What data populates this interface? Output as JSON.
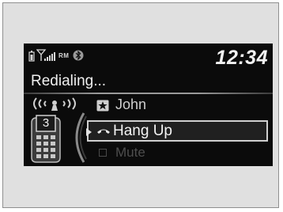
{
  "status": {
    "roaming_text": "RM",
    "clock": "12:34",
    "icons": [
      "phone-battery-icon",
      "signal-strength-icon",
      "bluetooth-icon"
    ]
  },
  "call": {
    "status": "Redialing...",
    "speed_dial_number": "3"
  },
  "menu": {
    "contact_name": "John",
    "contact_icon": "star-icon",
    "hang_up_label": "Hang Up",
    "hang_up_icon": "hang-up-icon",
    "mute_label": "Mute",
    "selected": "Hang Up"
  },
  "colors": {
    "screen_background": "#0b0b0b",
    "text_primary": "#f0f0f0",
    "text_disabled": "#4e4e4e"
  }
}
